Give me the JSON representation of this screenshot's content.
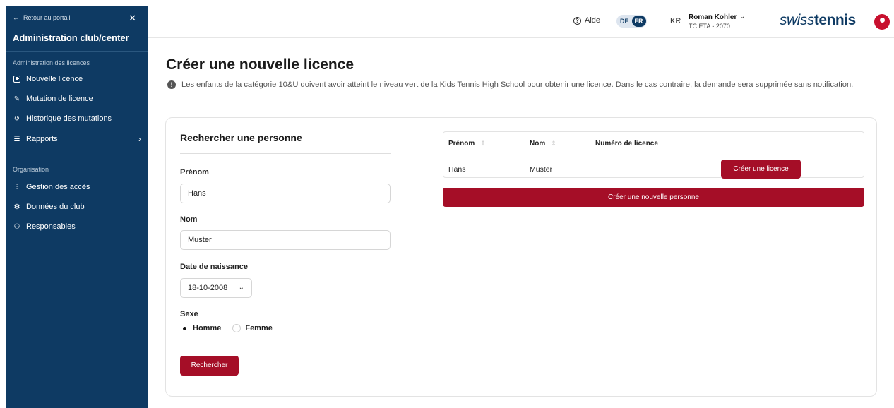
{
  "sidebar": {
    "back_label": "Retour au portail",
    "title": "Administration club/center",
    "section1": "Administration des licences",
    "items1": [
      {
        "label": "Nouvelle licence",
        "icon": "plus-box-icon"
      },
      {
        "label": "Mutation de licence",
        "icon": "edit-icon"
      },
      {
        "label": "Historique des mutations",
        "icon": "history-icon"
      },
      {
        "label": "Rapports",
        "icon": "list-icon"
      }
    ],
    "section2": "Organisation",
    "items2": [
      {
        "label": "Gestion des accès",
        "icon": "sliders-icon"
      },
      {
        "label": "Données du club",
        "icon": "gear-icon"
      },
      {
        "label": "Responsables",
        "icon": "users-icon"
      }
    ]
  },
  "header": {
    "help_label": "Aide",
    "lang_de": "DE",
    "lang_fr": "FR",
    "user_initials": "KR",
    "user_name": "Roman Kohler",
    "user_club": "TC ETA - 2070",
    "brand_part1": "swiss",
    "brand_part2": "tennis"
  },
  "main": {
    "title": "Créer une nouvelle licence",
    "notice": "Les enfants de la catégorie 10&U doivent avoir atteint le niveau vert de la Kids Tennis High School pour obtenir une licence. Dans le cas contraire, la demande sera supprimée sans notification."
  },
  "search_form": {
    "title": "Rechercher une personne",
    "first_name_label": "Prénom",
    "first_name_value": "Hans",
    "last_name_label": "Nom",
    "last_name_value": "Muster",
    "dob_label": "Date de naissance",
    "dob_value": "18-10-2008",
    "sex_label": "Sexe",
    "sex_options": [
      "Homme",
      "Femme"
    ],
    "sex_selected": "Homme",
    "search_button": "Rechercher"
  },
  "results": {
    "columns": [
      "Prénom",
      "Nom",
      "Numéro de licence"
    ],
    "rows": [
      {
        "first_name": "Hans",
        "last_name": "Muster",
        "license_number": "",
        "action": "Créer une licence"
      }
    ],
    "new_person_button": "Créer une nouvelle personne"
  },
  "colors": {
    "sidebar_bg": "#0e3a63",
    "primary_red": "#a50e27",
    "brand_blue": "#0e3a63"
  }
}
